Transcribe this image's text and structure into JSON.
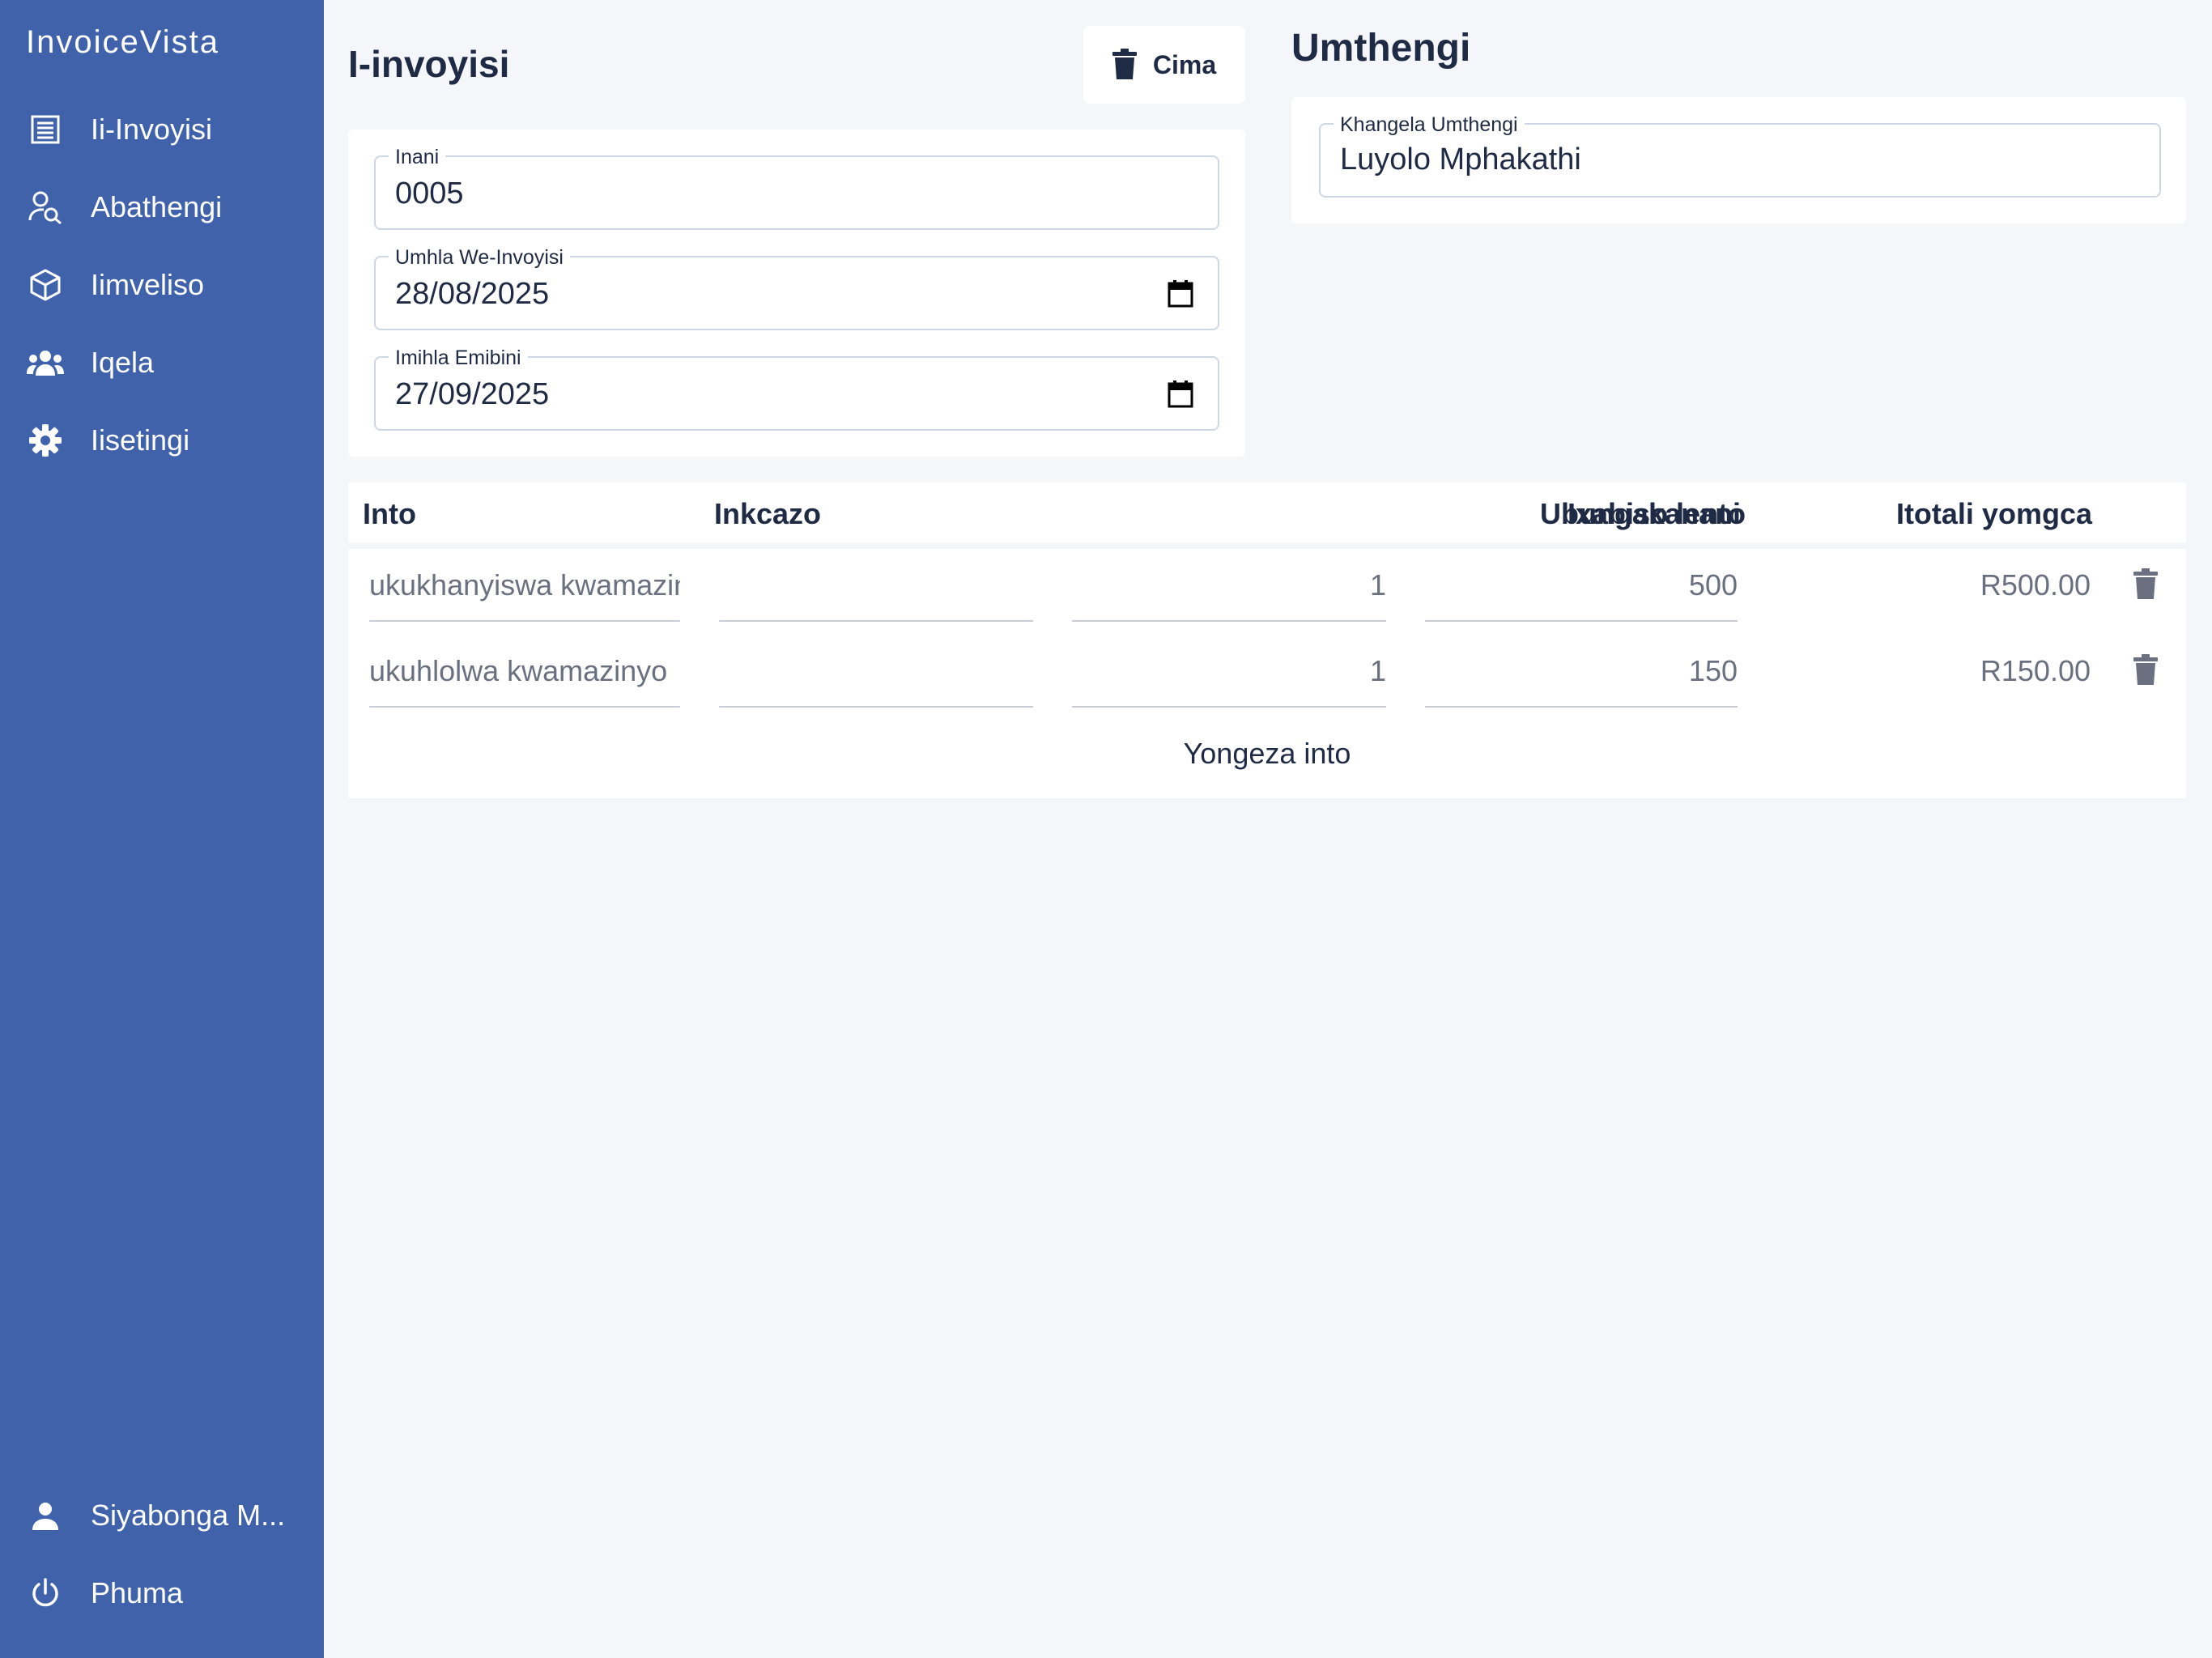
{
  "app": {
    "brand": "InvoiceVista"
  },
  "sidebar": {
    "items": [
      {
        "label": "Ii-Invoyisi",
        "icon": "receipt-icon"
      },
      {
        "label": "Abathengi",
        "icon": "user-search-icon"
      },
      {
        "label": "Iimveliso",
        "icon": "box-icon"
      },
      {
        "label": "Iqela",
        "icon": "team-icon"
      },
      {
        "label": "Iisetingi",
        "icon": "gear-icon"
      }
    ],
    "user": {
      "label": "Siyabonga M...",
      "icon": "person-icon"
    },
    "logout": {
      "label": "Phuma",
      "icon": "power-icon"
    }
  },
  "invoice": {
    "title": "I-invoyisi",
    "delete_label": "Cima",
    "fields": {
      "number": {
        "label": "Inani",
        "value": "0005"
      },
      "invoice_date": {
        "label": "Umhla We-Invoyisi",
        "value": "28/08/2025"
      },
      "due_date": {
        "label": "Imihla Emibini",
        "value": "27/09/2025"
      }
    }
  },
  "customer": {
    "title": "Umthengi",
    "search": {
      "label": "Khangela Umthengi",
      "value": "Luyolo Mphakathi"
    }
  },
  "table": {
    "headers": {
      "item": "Into",
      "description": "Inkcazo",
      "quantity": "Ubungakanani",
      "unit_price": "Ixabiso lento",
      "line_total": "Itotali yomgca"
    },
    "rows": [
      {
        "item": "ukukhanyiswa kwamazinyo",
        "description": "",
        "quantity": "1",
        "unit_price": "500",
        "line_total": "R500.00"
      },
      {
        "item": "ukuhlolwa kwamazinyo",
        "description": "",
        "quantity": "1",
        "unit_price": "150",
        "line_total": "R150.00"
      }
    ],
    "add_item_label": "Yongeza into"
  },
  "colors": {
    "sidebar": "#3f62ab",
    "background": "#f4f6fa",
    "text": "#1f2a44",
    "muted": "#6b7080"
  }
}
